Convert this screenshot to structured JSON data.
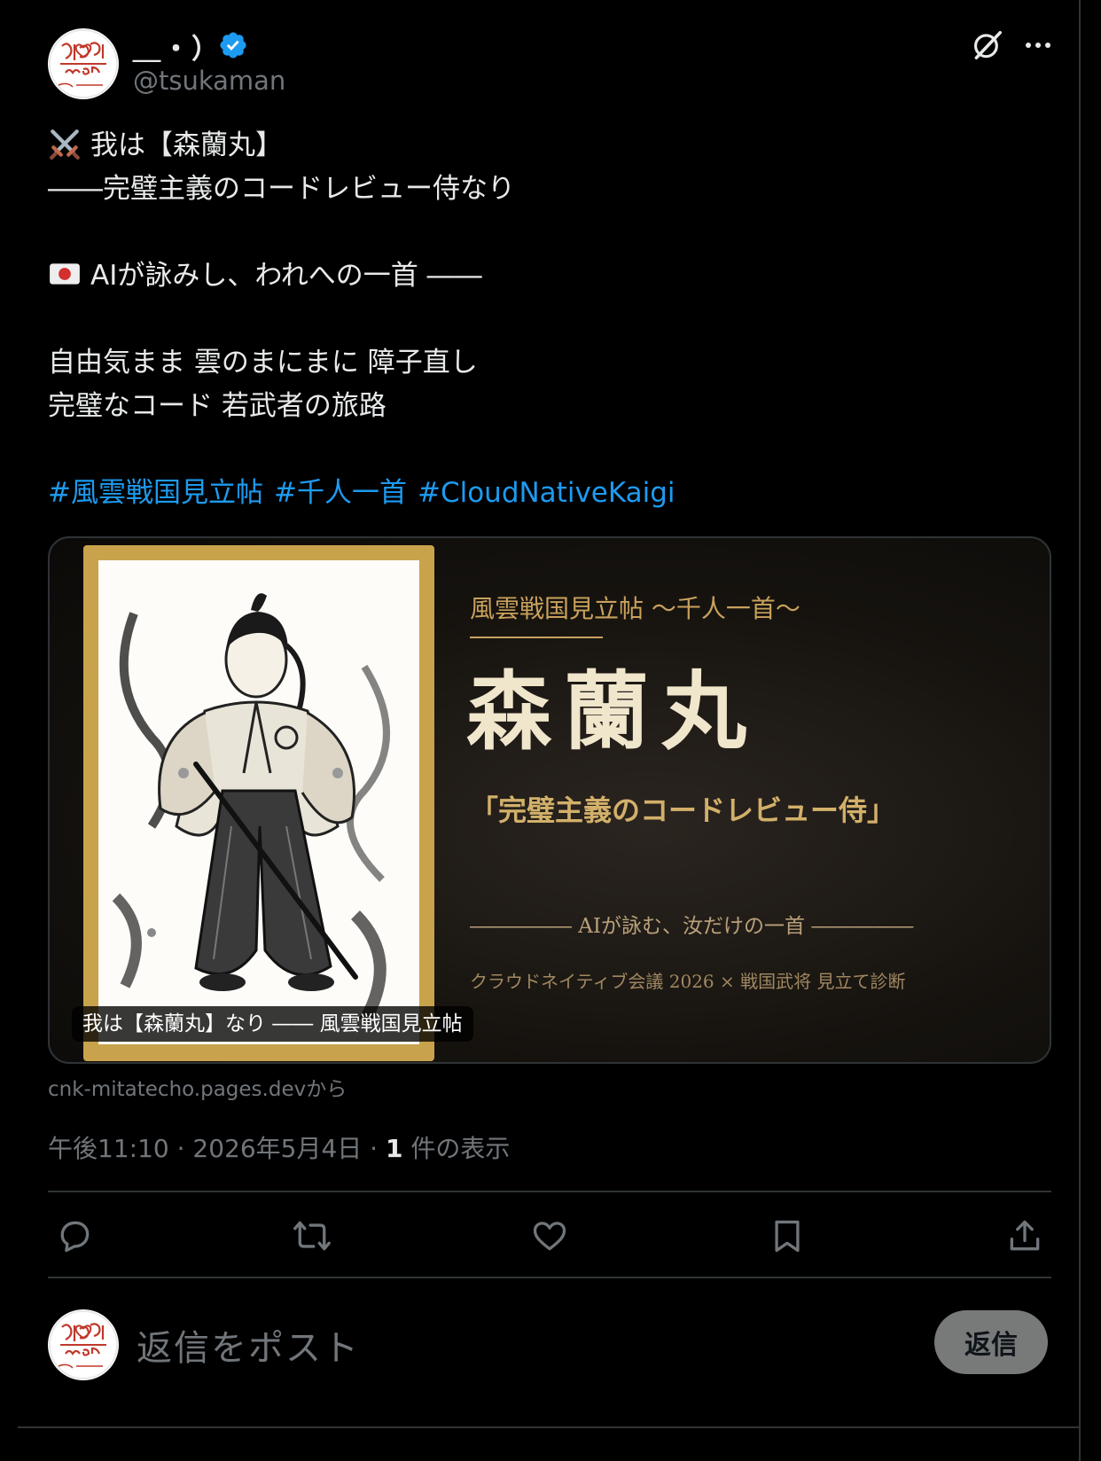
{
  "post": {
    "display_name": "＿・）",
    "handle": "@tsukaman",
    "verified": true,
    "lines": {
      "l1": "我は【森蘭丸】",
      "l2": "――完璧主義のコードレビュー侍なり",
      "l3": "AIが詠みし、われへの一首 ――",
      "l4": "自由気まま 雲のまにまに 障子直し",
      "l5": "完璧なコード 若武者の旅路"
    },
    "hashtags": [
      "#風雲戦国見立帖",
      "#千人一首",
      "#CloudNativeKaigi"
    ],
    "icons": {
      "line1": "crossed-swords-icon",
      "line3": "japan-flag-icon"
    }
  },
  "card": {
    "subtitle": "風雲戦国見立帖 〜千人一首〜",
    "title": "森蘭丸",
    "tagline": "「完璧主義のコードレビュー侍」",
    "ai_line": "――――― AIが詠む、汝だけの一首 ―――――",
    "footer": "クラウドネイティブ会議 2026 × 戦国武将 見立て診断",
    "caption": "我は【森蘭丸】なり ―― 風雲戦国見立帖",
    "source": "cnk-mitatecho.pages.devから"
  },
  "meta": {
    "time_date": "午後11:10 · 2026年5月4日 · ",
    "views_count": "1",
    "views_label": " 件の表示"
  },
  "actions": {
    "reply": "reply-icon",
    "repost": "repost-icon",
    "like": "like-icon",
    "bookmark": "bookmark-icon",
    "share": "share-icon"
  },
  "reply_box": {
    "placeholder": "返信をポスト",
    "button_label": "返信"
  },
  "colors": {
    "background": "#000000",
    "text": "#e7e9ea",
    "muted": "#71767b",
    "link": "#1d9bf0",
    "verified": "#1d9bf0",
    "card_gold": "#c9a24c",
    "reply_button": "#787a7a"
  }
}
